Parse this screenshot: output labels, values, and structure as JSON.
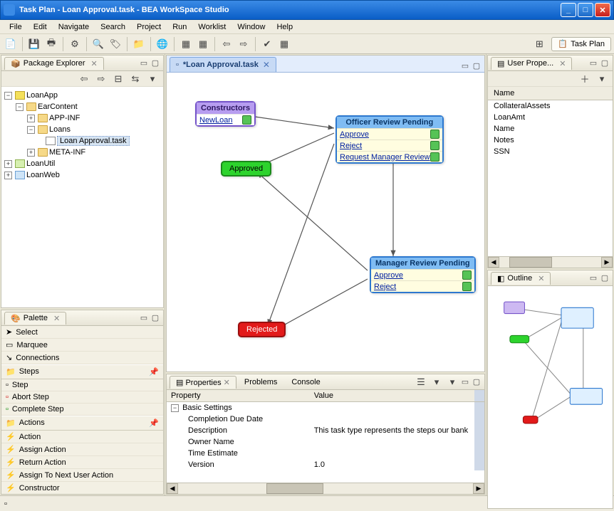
{
  "window": {
    "title": "Task Plan - Loan Approval.task - BEA WorkSpace Studio"
  },
  "menu": [
    "File",
    "Edit",
    "Navigate",
    "Search",
    "Project",
    "Run",
    "Worklist",
    "Window",
    "Help"
  ],
  "perspective": {
    "taskplan": "Task Plan"
  },
  "package_explorer": {
    "title": "Package Explorer",
    "items": {
      "root": "LoanApp",
      "ear": "EarContent",
      "appinf": "APP-INF",
      "loans": "Loans",
      "loanfile": "Loan Approval.task",
      "metainf": "META-INF",
      "loanutil": "LoanUtil",
      "loanweb": "LoanWeb"
    }
  },
  "editor": {
    "tab": "*Loan Approval.task",
    "constructors": {
      "title": "Constructors",
      "row": "NewLoan"
    },
    "officer": {
      "title": "Officer Review Pending",
      "r1": "Approve",
      "r2": "Reject",
      "r3": "Request Manager Review"
    },
    "manager": {
      "title": "Manager Review Pending",
      "r1": "Approve",
      "r2": "Reject"
    },
    "approved": "Approved",
    "rejected": "Rejected"
  },
  "palette": {
    "title": "Palette",
    "select": "Select",
    "marquee": "Marquee",
    "connections": "Connections",
    "steps": "Steps",
    "step": "Step",
    "abort": "Abort Step",
    "complete": "Complete Step",
    "actions": "Actions",
    "action": "Action",
    "assign": "Assign Action",
    "return": "Return Action",
    "assignnext": "Assign To Next User Action",
    "constructor": "Constructor"
  },
  "properties": {
    "title": "Properties",
    "tabs": {
      "problems": "Problems",
      "console": "Console"
    },
    "col1": "Property",
    "col2": "Value",
    "group": "Basic Settings",
    "rows": {
      "cdd": {
        "k": "Completion Due Date",
        "v": ""
      },
      "desc": {
        "k": "Description",
        "v": "This task type represents the steps our bank"
      },
      "owner": {
        "k": "Owner Name",
        "v": ""
      },
      "time": {
        "k": "Time Estimate",
        "v": ""
      },
      "ver": {
        "k": "Version",
        "v": "1.0"
      }
    }
  },
  "user_props": {
    "title": "User Prope...",
    "col": "Name",
    "rows": [
      "CollateralAssets",
      "LoanAmt",
      "Name",
      "Notes",
      "SSN"
    ]
  },
  "outline": {
    "title": "Outline"
  }
}
